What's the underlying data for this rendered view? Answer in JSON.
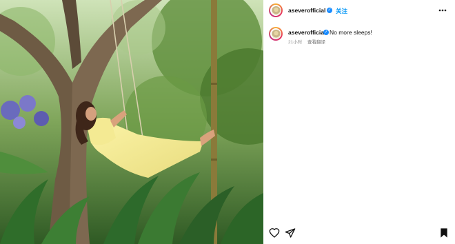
{
  "post": {
    "author": {
      "username": "aseverofficial",
      "verified_icon": "verified-badge-icon",
      "follow_label": "关注"
    },
    "caption": {
      "username": "aseverofficial",
      "text": "No more sleeps!",
      "timestamp": "21小时",
      "translate_label": "查看翻译"
    },
    "image": {
      "description_icon": "photo-of-woman-on-swing"
    }
  },
  "icons": {
    "more": "more-horizontal-icon",
    "like": "heart-icon",
    "share": "share-send-icon",
    "save": "bookmark-icon"
  },
  "colors": {
    "accent": "#0095f6",
    "verified": "#1a8cff",
    "muted": "#8e8e8e"
  }
}
